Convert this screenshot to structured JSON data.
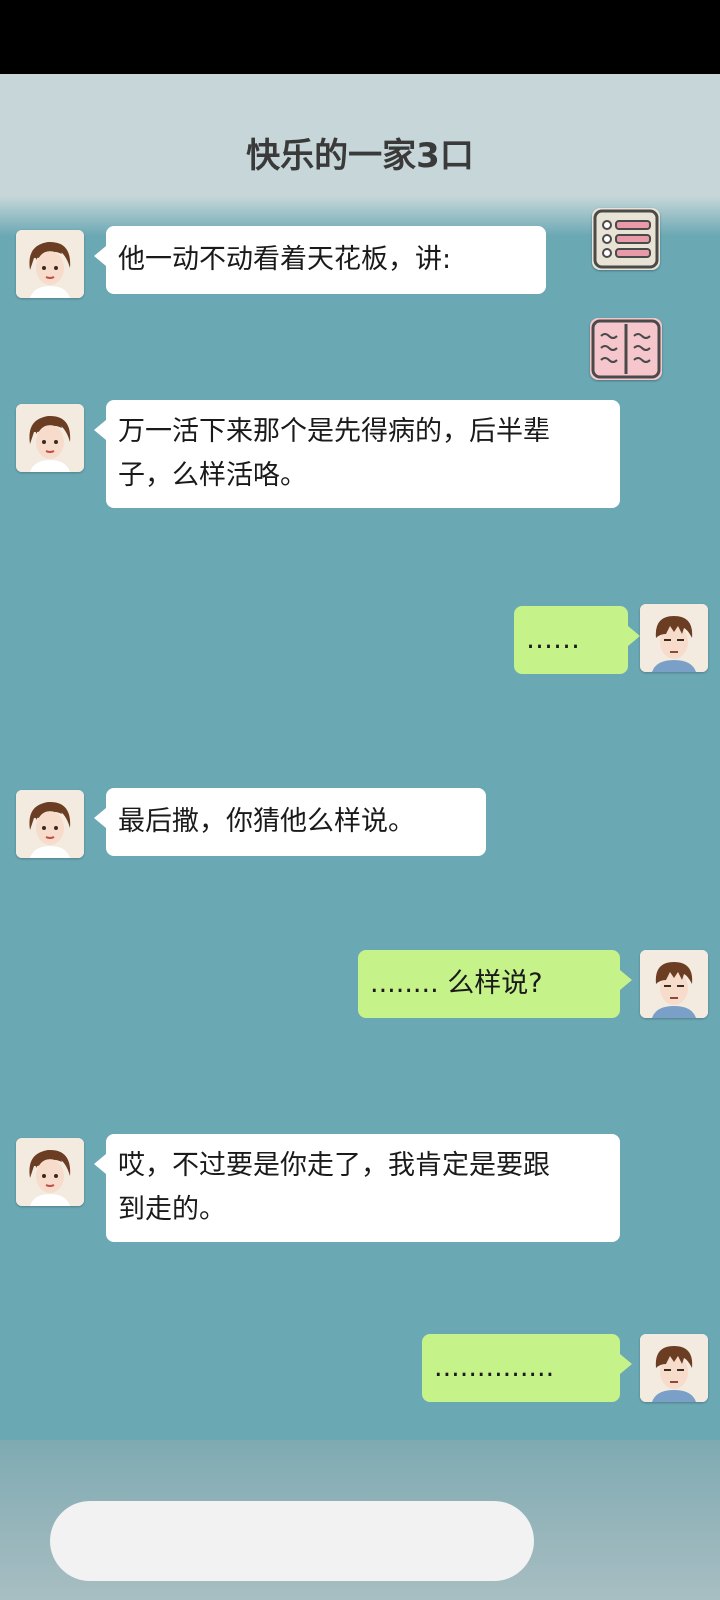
{
  "header": {
    "title": "快乐的一家3口"
  },
  "side_buttons": {
    "menu_icon": "list-menu-icon",
    "book_icon": "open-book-icon"
  },
  "colors": {
    "background": "#6aa8b4",
    "left_bubble": "#ffffff",
    "right_bubble": "#c6f28a"
  },
  "messages": [
    {
      "side": "left",
      "sender": "woman",
      "lines": [
        "他一动不动看着天花板，讲:"
      ]
    },
    {
      "side": "left",
      "sender": "woman",
      "lines": [
        "万一活下来那个是先得病的，后半辈",
        "子，么样活咯。"
      ]
    },
    {
      "side": "right",
      "sender": "man",
      "lines": [
        "……"
      ]
    },
    {
      "side": "left",
      "sender": "woman",
      "lines": [
        "最后撒，你猜他么样说。"
      ]
    },
    {
      "side": "right",
      "sender": "man",
      "lines": [
        "........ 么样说?"
      ]
    },
    {
      "side": "left",
      "sender": "woman",
      "lines": [
        "哎，不过要是你走了，我肯定是要跟",
        "到走的。"
      ]
    },
    {
      "side": "right",
      "sender": "man",
      "lines": [
        ".............."
      ]
    }
  ],
  "input": {
    "placeholder": ""
  }
}
